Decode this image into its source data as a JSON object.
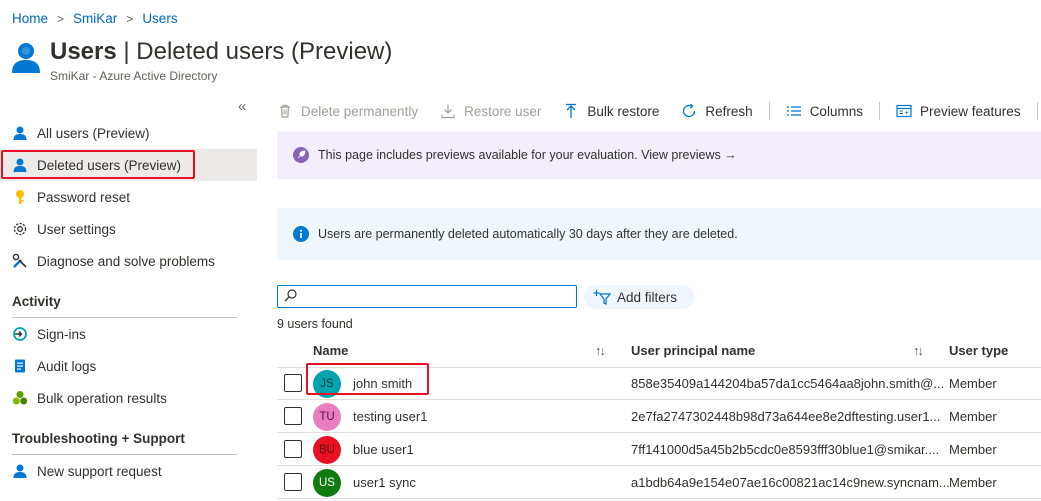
{
  "breadcrumb": {
    "items": [
      "Home",
      "SmiKar",
      "Users"
    ],
    "separator": ">"
  },
  "header": {
    "title_bold": "Users",
    "title_rest": " | Deleted users (Preview)",
    "subtitle": "SmiKar - Azure Active Directory"
  },
  "sidebar": {
    "collapse_glyph": "«",
    "items": [
      {
        "label": "All users (Preview)",
        "icon": "user-icon"
      },
      {
        "label": "Deleted users (Preview)",
        "icon": "user-icon",
        "selected": true
      },
      {
        "label": "Password reset",
        "icon": "key-icon"
      },
      {
        "label": "User settings",
        "icon": "gear-icon"
      },
      {
        "label": "Diagnose and solve problems",
        "icon": "wrench-icon"
      }
    ],
    "sections": [
      {
        "title": "Activity",
        "items": [
          {
            "label": "Sign-ins",
            "icon": "signin-icon"
          },
          {
            "label": "Audit logs",
            "icon": "audit-log-icon"
          },
          {
            "label": "Bulk operation results",
            "icon": "bulk-results-icon"
          }
        ]
      },
      {
        "title": "Troubleshooting + Support",
        "items": [
          {
            "label": "New support request",
            "icon": "user-support-icon"
          }
        ]
      }
    ]
  },
  "toolbar": {
    "delete_label": "Delete permanently",
    "restore_label": "Restore user",
    "bulk_restore_label": "Bulk restore",
    "refresh_label": "Refresh",
    "columns_label": "Columns",
    "preview_features_label": "Preview features"
  },
  "banners": {
    "preview_text": "This page includes previews available for your evaluation. View previews →",
    "info_text": "Users are permanently deleted automatically 30 days after they are deleted."
  },
  "search": {
    "value": "",
    "placeholder": ""
  },
  "filters": {
    "add_label": "Add filters"
  },
  "results": {
    "count_text": "9 users found"
  },
  "table": {
    "columns": {
      "name": "Name",
      "upn": "User principal name",
      "type": "User type"
    },
    "sort_glyph": "↑↓",
    "rows": [
      {
        "initials": "JS",
        "avatar_color": "#00a3ae",
        "avatar_text_color": "#0b3b3e",
        "name": "john smith",
        "upn": "858e35409a144204ba57da1cc5464aa8john.smith@...",
        "type": "Member"
      },
      {
        "initials": "TU",
        "avatar_color": "#e97dc2",
        "avatar_text_color": "#4a1238",
        "name": "testing user1",
        "upn": "2e7fa2747302448b98d73a644ee8e2dftesting.user1...",
        "type": "Member"
      },
      {
        "initials": "BU",
        "avatar_color": "#e81123",
        "avatar_text_color": "#5a0a10",
        "name": "blue user1",
        "upn": "7ff141000d5a45b2b5cdc0e8593fff30blue1@smikar....",
        "type": "Member"
      },
      {
        "initials": "US",
        "avatar_color": "#107c10",
        "avatar_text_color": "#ffffff",
        "name": "user1 sync",
        "upn": "a1bdb64a9e154e07ae16c00821ac14c9new.syncnam...",
        "type": "Member"
      }
    ]
  },
  "colors": {
    "accent": "#0078d4",
    "link": "#0067b8",
    "highlight_border": "#e81123"
  }
}
